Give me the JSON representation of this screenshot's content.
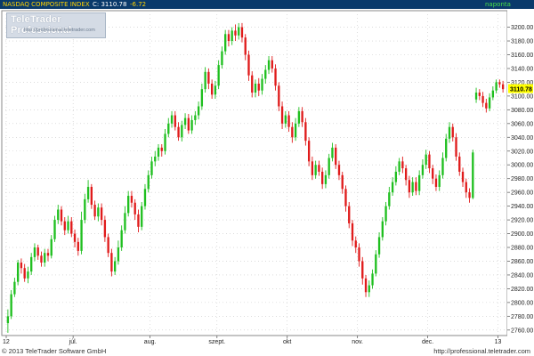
{
  "header": {
    "instrument": "NASDAQ COMPOSITE INDEX",
    "close_label": "C: 3110.78",
    "change": "-6.72",
    "period": "naponta"
  },
  "logo": {
    "brand": "TeleTrader Professional",
    "url": "http://professional.teletrader.com"
  },
  "footer": {
    "copyright": "© 2013 TeleTrader Software GmbH",
    "url": "http://professional.teletrader.com"
  },
  "colors": {
    "up": "#1fbf1f",
    "down": "#e01b1b",
    "grid": "#c8c8c8",
    "header_bg": "#0a3a6b",
    "instrument_text": "#ffd200",
    "price_text": "#ffffff",
    "change_text": "#ffd200",
    "period_text": "#48e048",
    "last_price_tag": "#ffff00"
  },
  "chart_data": {
    "type": "candlestick",
    "ylim": [
      2752,
      3224
    ],
    "y_ticks": [
      2760,
      2780,
      2800,
      2820,
      2840,
      2860,
      2880,
      2900,
      2920,
      2940,
      2960,
      2980,
      3000,
      3020,
      3040,
      3060,
      3080,
      3100,
      3120,
      3140,
      3160,
      3180,
      3200
    ],
    "last_price": 3110.78,
    "last_price_label": "3110.78",
    "x_tick_labels": [
      "12",
      "júl.",
      "aug.",
      "szept.",
      "okt",
      "nov.",
      "dec.",
      "13"
    ],
    "x_ticks_at_candle": [
      0,
      20,
      43,
      63,
      84,
      105,
      126,
      147
    ],
    "grid": true,
    "candles": [
      [
        2770,
        2780,
        2756,
        2790
      ],
      [
        2780,
        2812,
        2776,
        2818
      ],
      [
        2812,
        2830,
        2808,
        2836
      ],
      [
        2830,
        2858,
        2825,
        2862
      ],
      [
        2858,
        2850,
        2842,
        2864
      ],
      [
        2850,
        2835,
        2830,
        2856
      ],
      [
        2835,
        2845,
        2828,
        2852
      ],
      [
        2845,
        2866,
        2840,
        2872
      ],
      [
        2866,
        2880,
        2860,
        2886
      ],
      [
        2880,
        2868,
        2862,
        2884
      ],
      [
        2868,
        2858,
        2852,
        2874
      ],
      [
        2858,
        2872,
        2852,
        2878
      ],
      [
        2872,
        2868,
        2860,
        2878
      ],
      [
        2868,
        2892,
        2864,
        2898
      ],
      [
        2892,
        2920,
        2888,
        2926
      ],
      [
        2920,
        2935,
        2914,
        2942
      ],
      [
        2935,
        2918,
        2912,
        2940
      ],
      [
        2918,
        2905,
        2898,
        2924
      ],
      [
        2905,
        2918,
        2900,
        2926
      ],
      [
        2918,
        2900,
        2895,
        2924
      ],
      [
        2900,
        2888,
        2880,
        2906
      ],
      [
        2888,
        2875,
        2868,
        2894
      ],
      [
        2875,
        2920,
        2870,
        2932
      ],
      [
        2920,
        2950,
        2915,
        2958
      ],
      [
        2950,
        2968,
        2945,
        2978
      ],
      [
        2968,
        2942,
        2936,
        2972
      ],
      [
        2942,
        2925,
        2920,
        2948
      ],
      [
        2925,
        2938,
        2918,
        2944
      ],
      [
        2938,
        2920,
        2912,
        2944
      ],
      [
        2920,
        2895,
        2888,
        2926
      ],
      [
        2895,
        2872,
        2866,
        2900
      ],
      [
        2872,
        2845,
        2838,
        2878
      ],
      [
        2845,
        2860,
        2840,
        2866
      ],
      [
        2860,
        2880,
        2855,
        2890
      ],
      [
        2880,
        2905,
        2875,
        2912
      ],
      [
        2905,
        2930,
        2900,
        2940
      ],
      [
        2930,
        2955,
        2925,
        2962
      ],
      [
        2955,
        2945,
        2938,
        2962
      ],
      [
        2945,
        2928,
        2920,
        2950
      ],
      [
        2928,
        2910,
        2902,
        2935
      ],
      [
        2910,
        2940,
        2905,
        2946
      ],
      [
        2940,
        2965,
        2935,
        2972
      ],
      [
        2965,
        2985,
        2960,
        2992
      ],
      [
        2985,
        3005,
        2980,
        3012
      ],
      [
        3005,
        3012,
        2998,
        3020
      ],
      [
        3012,
        3025,
        3006,
        3030
      ],
      [
        3025,
        3020,
        3012,
        3030
      ],
      [
        3020,
        3045,
        3015,
        3052
      ],
      [
        3045,
        3060,
        3040,
        3068
      ],
      [
        3060,
        3072,
        3054,
        3078
      ],
      [
        3072,
        3055,
        3050,
        3078
      ],
      [
        3055,
        3040,
        3035,
        3062
      ],
      [
        3040,
        3058,
        3034,
        3064
      ],
      [
        3058,
        3068,
        3052,
        3075
      ],
      [
        3068,
        3050,
        3045,
        3074
      ],
      [
        3050,
        3065,
        3045,
        3072
      ],
      [
        3065,
        3072,
        3058,
        3078
      ],
      [
        3072,
        3085,
        3066,
        3092
      ],
      [
        3085,
        3110,
        3080,
        3118
      ],
      [
        3110,
        3135,
        3105,
        3142
      ],
      [
        3135,
        3118,
        3110,
        3140
      ],
      [
        3118,
        3102,
        3096,
        3124
      ],
      [
        3102,
        3115,
        3096,
        3122
      ],
      [
        3115,
        3145,
        3110,
        3152
      ],
      [
        3145,
        3165,
        3140,
        3172
      ],
      [
        3165,
        3190,
        3160,
        3196
      ],
      [
        3190,
        3180,
        3172,
        3196
      ],
      [
        3180,
        3195,
        3174,
        3200
      ],
      [
        3195,
        3188,
        3180,
        3204
      ],
      [
        3188,
        3200,
        3182,
        3206
      ],
      [
        3200,
        3185,
        3178,
        3206
      ],
      [
        3185,
        3160,
        3152,
        3190
      ],
      [
        3160,
        3130,
        3122,
        3166
      ],
      [
        3130,
        3105,
        3098,
        3136
      ],
      [
        3105,
        3118,
        3098,
        3124
      ],
      [
        3118,
        3108,
        3100,
        3126
      ],
      [
        3108,
        3125,
        3102,
        3132
      ],
      [
        3125,
        3138,
        3118,
        3145
      ],
      [
        3138,
        3152,
        3132,
        3158
      ],
      [
        3152,
        3140,
        3134,
        3158
      ],
      [
        3140,
        3115,
        3108,
        3146
      ],
      [
        3115,
        3085,
        3078,
        3120
      ],
      [
        3085,
        3060,
        3052,
        3092
      ],
      [
        3060,
        3072,
        3054,
        3078
      ],
      [
        3072,
        3055,
        3048,
        3078
      ],
      [
        3055,
        3040,
        3032,
        3062
      ],
      [
        3040,
        3060,
        3035,
        3068
      ],
      [
        3060,
        3078,
        3055,
        3084
      ],
      [
        3078,
        3062,
        3055,
        3084
      ],
      [
        3062,
        3035,
        3028,
        3068
      ],
      [
        3035,
        3005,
        2998,
        3040
      ],
      [
        3005,
        2985,
        2978,
        3012
      ],
      [
        2985,
        3000,
        2980,
        3006
      ],
      [
        3000,
        2990,
        2984,
        3006
      ],
      [
        2990,
        2972,
        2965,
        2996
      ],
      [
        2972,
        2985,
        2966,
        2992
      ],
      [
        2985,
        3010,
        2980,
        3016
      ],
      [
        3010,
        3025,
        3005,
        3032
      ],
      [
        3025,
        3000,
        2994,
        3030
      ],
      [
        3000,
        2985,
        2978,
        3006
      ],
      [
        2985,
        2965,
        2958,
        2990
      ],
      [
        2965,
        2940,
        2932,
        2970
      ],
      [
        2940,
        2915,
        2908,
        2946
      ],
      [
        2915,
        2890,
        2882,
        2920
      ],
      [
        2890,
        2880,
        2872,
        2896
      ],
      [
        2880,
        2860,
        2852,
        2886
      ],
      [
        2860,
        2835,
        2826,
        2866
      ],
      [
        2835,
        2815,
        2808,
        2840
      ],
      [
        2815,
        2825,
        2808,
        2832
      ],
      [
        2825,
        2842,
        2820,
        2848
      ],
      [
        2842,
        2870,
        2838,
        2876
      ],
      [
        2870,
        2895,
        2865,
        2902
      ],
      [
        2895,
        2918,
        2890,
        2924
      ],
      [
        2918,
        2940,
        2912,
        2946
      ],
      [
        2940,
        2960,
        2935,
        2968
      ],
      [
        2960,
        2975,
        2955,
        2982
      ],
      [
        2975,
        2990,
        2970,
        2998
      ],
      [
        2990,
        3005,
        2985,
        3010
      ],
      [
        3005,
        2995,
        2988,
        3012
      ],
      [
        2995,
        2978,
        2970,
        3000
      ],
      [
        2978,
        2960,
        2952,
        2984
      ],
      [
        2960,
        2975,
        2955,
        2982
      ],
      [
        2975,
        2962,
        2956,
        2982
      ],
      [
        2962,
        2985,
        2956,
        2992
      ],
      [
        2985,
        3000,
        2980,
        3008
      ],
      [
        3000,
        3015,
        2994,
        3022
      ],
      [
        3015,
        2995,
        2988,
        3020
      ],
      [
        2995,
        2980,
        2972,
        3000
      ],
      [
        2980,
        2968,
        2962,
        2986
      ],
      [
        2968,
        2985,
        2962,
        2992
      ],
      [
        2985,
        3010,
        2980,
        3018
      ],
      [
        3010,
        3038,
        3005,
        3045
      ],
      [
        3038,
        3055,
        3032,
        3062
      ],
      [
        3055,
        3040,
        3034,
        3060
      ],
      [
        3040,
        3012,
        3006,
        3046
      ],
      [
        3012,
        2990,
        2984,
        3018
      ],
      [
        2990,
        2975,
        2968,
        2996
      ],
      [
        2975,
        2960,
        2952,
        2980
      ],
      [
        2960,
        2952,
        2945,
        2966
      ],
      [
        2952,
        3018,
        2950,
        3022
      ],
      [
        3095,
        3105,
        3090,
        3112
      ],
      [
        3105,
        3100,
        3094,
        3110
      ],
      [
        3100,
        3090,
        3084,
        3106
      ],
      [
        3090,
        3082,
        3076,
        3096
      ],
      [
        3082,
        3098,
        3078,
        3104
      ],
      [
        3098,
        3108,
        3094,
        3114
      ],
      [
        3108,
        3120,
        3104,
        3124
      ],
      [
        3120,
        3117,
        3112,
        3124
      ],
      [
        3117,
        3110,
        3105,
        3122
      ]
    ]
  }
}
